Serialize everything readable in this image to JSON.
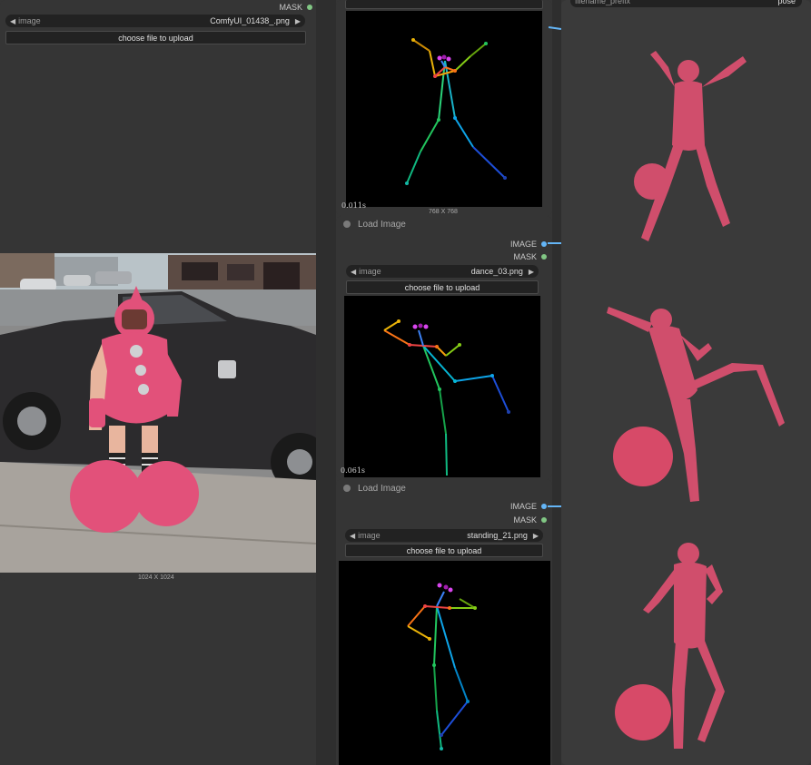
{
  "colors": {
    "background": "#353535",
    "image_port": "#64b5f6",
    "mask_port": "#81c784",
    "pink": "#e54a72"
  },
  "top_left_node": {
    "mask_label": "MASK",
    "combo_label": "image",
    "combo_value": "ComfyUI_01438_.png",
    "upload_label": "choose file to upload",
    "preview_dims": "1024 X 1024"
  },
  "pose_node_1": {
    "timer": "0.011s",
    "preview_dims": "768 X 768"
  },
  "load_image_2": {
    "title": "Load Image",
    "image_output": "IMAGE",
    "mask_output": "MASK",
    "combo_label": "image",
    "combo_value": "dance_03.png",
    "upload_label": "choose file to upload",
    "timer": "0.061s"
  },
  "load_image_3": {
    "title": "Load Image",
    "image_output": "IMAGE",
    "mask_output": "MASK",
    "combo_label": "image",
    "combo_value": "standing_21.png",
    "upload_label": "choose file to upload"
  },
  "right_node": {
    "field_label": "filename_prefix",
    "field_value": "pose"
  }
}
